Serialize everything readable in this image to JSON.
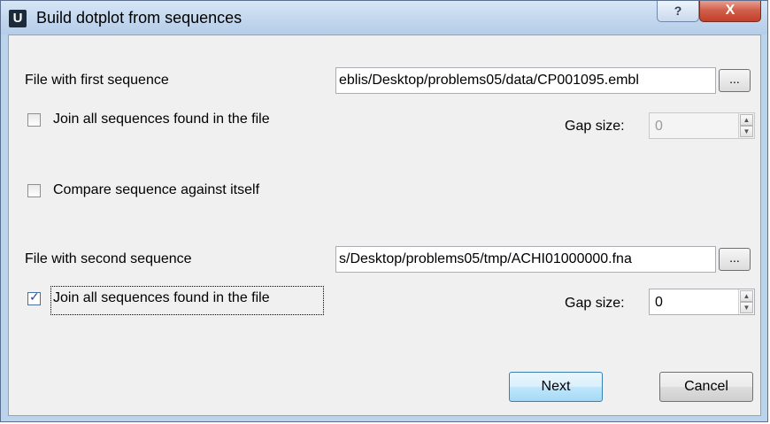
{
  "window": {
    "app_icon_letter": "U",
    "title": "Build dotplot from sequences",
    "help_glyph": "?",
    "close_glyph": "X"
  },
  "first": {
    "label": "File with first sequence",
    "path": "eblis/Desktop/problems05/data/CP001095.embl",
    "browse_label": "...",
    "join_label": "Join all sequences found in the file",
    "join_checked": false,
    "gap_label": "Gap size:",
    "gap_value": "0",
    "gap_enabled": false
  },
  "compare": {
    "label": "Compare sequence against itself",
    "checked": false
  },
  "second": {
    "label": "File with second sequence",
    "path": "s/Desktop/problems05/tmp/ACHI01000000.fna",
    "browse_label": "...",
    "join_label": "Join all sequences found in the file",
    "join_checked": true,
    "gap_label": "Gap size:",
    "gap_value": "0",
    "gap_enabled": true
  },
  "buttons": {
    "next": "Next",
    "cancel": "Cancel"
  },
  "icons": {
    "checkmark": "✓",
    "spin_up": "▲",
    "spin_down": "▼"
  }
}
